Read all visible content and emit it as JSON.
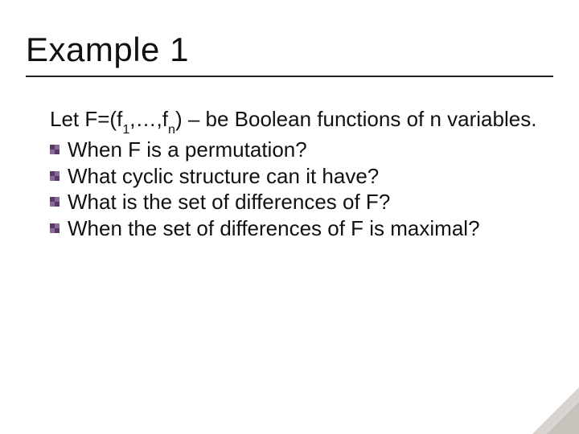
{
  "title": "Example 1",
  "lead": {
    "prefix": "Let F=(f",
    "sub1": "1",
    "mid": ",…,f",
    "sub2": "n",
    "suffix": ") – be Boolean functions of n variables."
  },
  "bullets": [
    "When F is a permutation?",
    "What cyclic structure can it have?",
    "What is the set of differences of F?",
    "When the set of differences of F is maximal?"
  ]
}
